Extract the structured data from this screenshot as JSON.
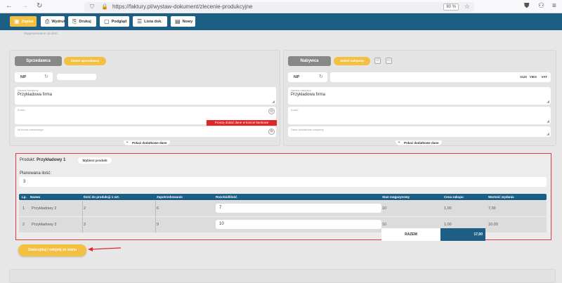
{
  "browser": {
    "url": "https://faktury.pl/wystaw-dokument/zlecenie-produkcyjne",
    "zoom": "80 %"
  },
  "toolbar": {
    "save": "Zapisz",
    "print": "Wydruk",
    "download": "Drukuj",
    "preview": "Podgląd",
    "doclist": "Lista dok.",
    "new": "Nowy"
  },
  "breadcrumb": "Wygenerowane od ofert",
  "seller": {
    "header": "Sprzedawca",
    "action": "Zmień sprzedawcę",
    "nip_label": "NIP",
    "name_label": "Nazwa Nabywcy",
    "name_value": "Przykładowa firma",
    "addr_label": "Konto",
    "account_label": "Nr konta bankowego",
    "error": "Proszę dodać dane w koncie bankowe",
    "more": "Pokaż dodatkowe dane"
  },
  "buyer": {
    "header": "Nabywca",
    "action": "Zmień nabywcę",
    "nip_label": "NIP",
    "gus": "GUS",
    "vies": "VIES",
    "vat": "VAT",
    "name_label": "Nazwa nabywcy",
    "name_value": "Przykładowa firma",
    "addr_label": "Konto",
    "extra_label": "Dane dodatkowe nabywcy",
    "more": "Pokaż dodatkowe dane"
  },
  "product": {
    "label": "Produkt:",
    "name": "Przykładowy 1",
    "choose": "Wybierz produkt",
    "planned_label": "Planowana ilość:",
    "planned_value": "3"
  },
  "table": {
    "columns": [
      "Lp.",
      "Nazwa",
      "Ilość do produkcji 1 szt.",
      "Zapotrzebowanie",
      "Rozchód/ilość",
      "Stan magazynowy",
      "Cena zakupu",
      "Wartość wydania"
    ],
    "rows": [
      [
        "1",
        "Przykładowy 2",
        "2",
        "6",
        "7",
        "10",
        "1,00",
        "7,00"
      ],
      [
        "2",
        "Przykładowy 3",
        "3",
        "9",
        "10",
        "10",
        "1,00",
        "10,00"
      ]
    ],
    "total_label": "RAZEM",
    "total_value": "17,00"
  },
  "accept_button": "Zaakceptuj i odejmij ze stanu",
  "colors": {
    "toolbar": "#1d5f84",
    "accent": "#f3c042",
    "error": "#e02626",
    "highlight": "#e03b3b"
  }
}
